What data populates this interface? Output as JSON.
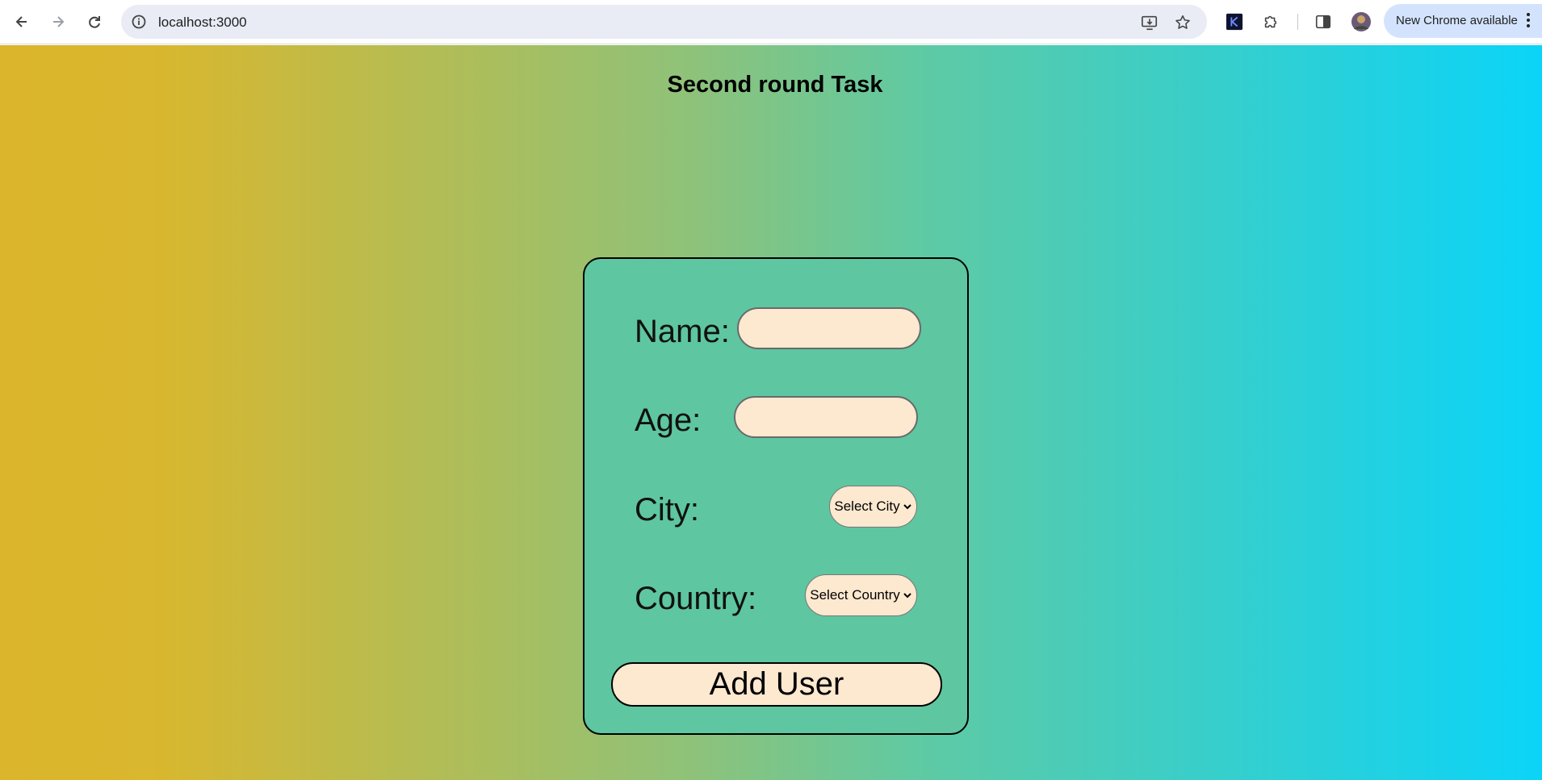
{
  "browser": {
    "url": "localhost:3000",
    "update_label": "New Chrome available",
    "icons": {
      "back": "arrow-left-icon",
      "forward": "arrow-right-icon",
      "reload": "reload-icon",
      "site_info": "info-icon",
      "install": "install-app-icon",
      "bookmark": "star-icon",
      "extension_k": "k-extension-icon",
      "extensions": "puzzle-icon",
      "side_panel": "side-panel-icon",
      "profile": "avatar",
      "menu": "kebab-menu-icon"
    }
  },
  "page": {
    "title": "Second round Task",
    "gradient": [
      "#dbb52c",
      "#8ec27a",
      "#0bd4f8"
    ]
  },
  "form": {
    "name_label": "Name:",
    "name_value": "",
    "age_label": "Age:",
    "age_value": "",
    "city_label": "City:",
    "city_select": "Select City",
    "country_label": "Country:",
    "country_select": "Select Country",
    "submit_label": "Add User",
    "input_fill": "#fde8d0"
  }
}
